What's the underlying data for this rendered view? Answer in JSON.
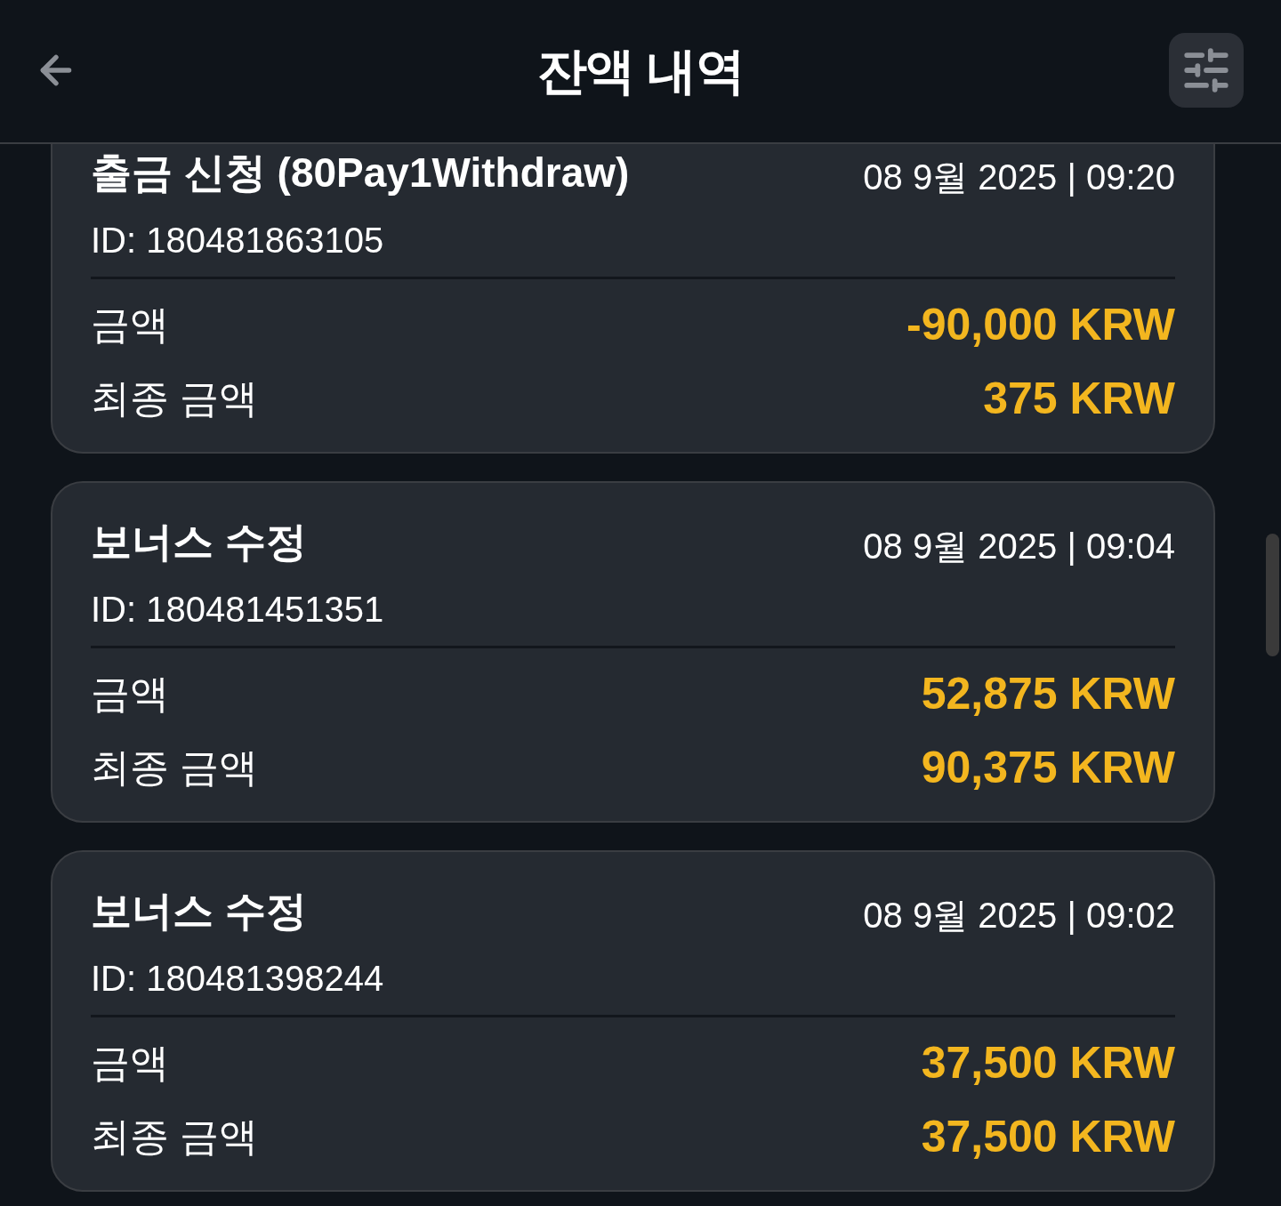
{
  "header": {
    "title": "잔액 내역"
  },
  "transactions": [
    {
      "title": "출금 신청 (80Pay1Withdraw)",
      "datetime": "08 9월 2025 | 09:20",
      "id": "ID: 180481863105",
      "rows": [
        {
          "label": "금액",
          "value": "-90,000 KRW"
        },
        {
          "label": "최종 금액",
          "value": "375 KRW"
        }
      ]
    },
    {
      "title": "보너스 수정",
      "datetime": "08 9월 2025 | 09:04",
      "id": "ID: 180481451351",
      "rows": [
        {
          "label": "금액",
          "value": "52,875 KRW"
        },
        {
          "label": "최종 금액",
          "value": "90,375 KRW"
        }
      ]
    },
    {
      "title": "보너스 수정",
      "datetime": "08 9월 2025 | 09:02",
      "id": "ID: 180481398244",
      "rows": [
        {
          "label": "금액",
          "value": "37,500 KRW"
        },
        {
          "label": "최종 금액",
          "value": "37,500 KRW"
        }
      ]
    }
  ]
}
